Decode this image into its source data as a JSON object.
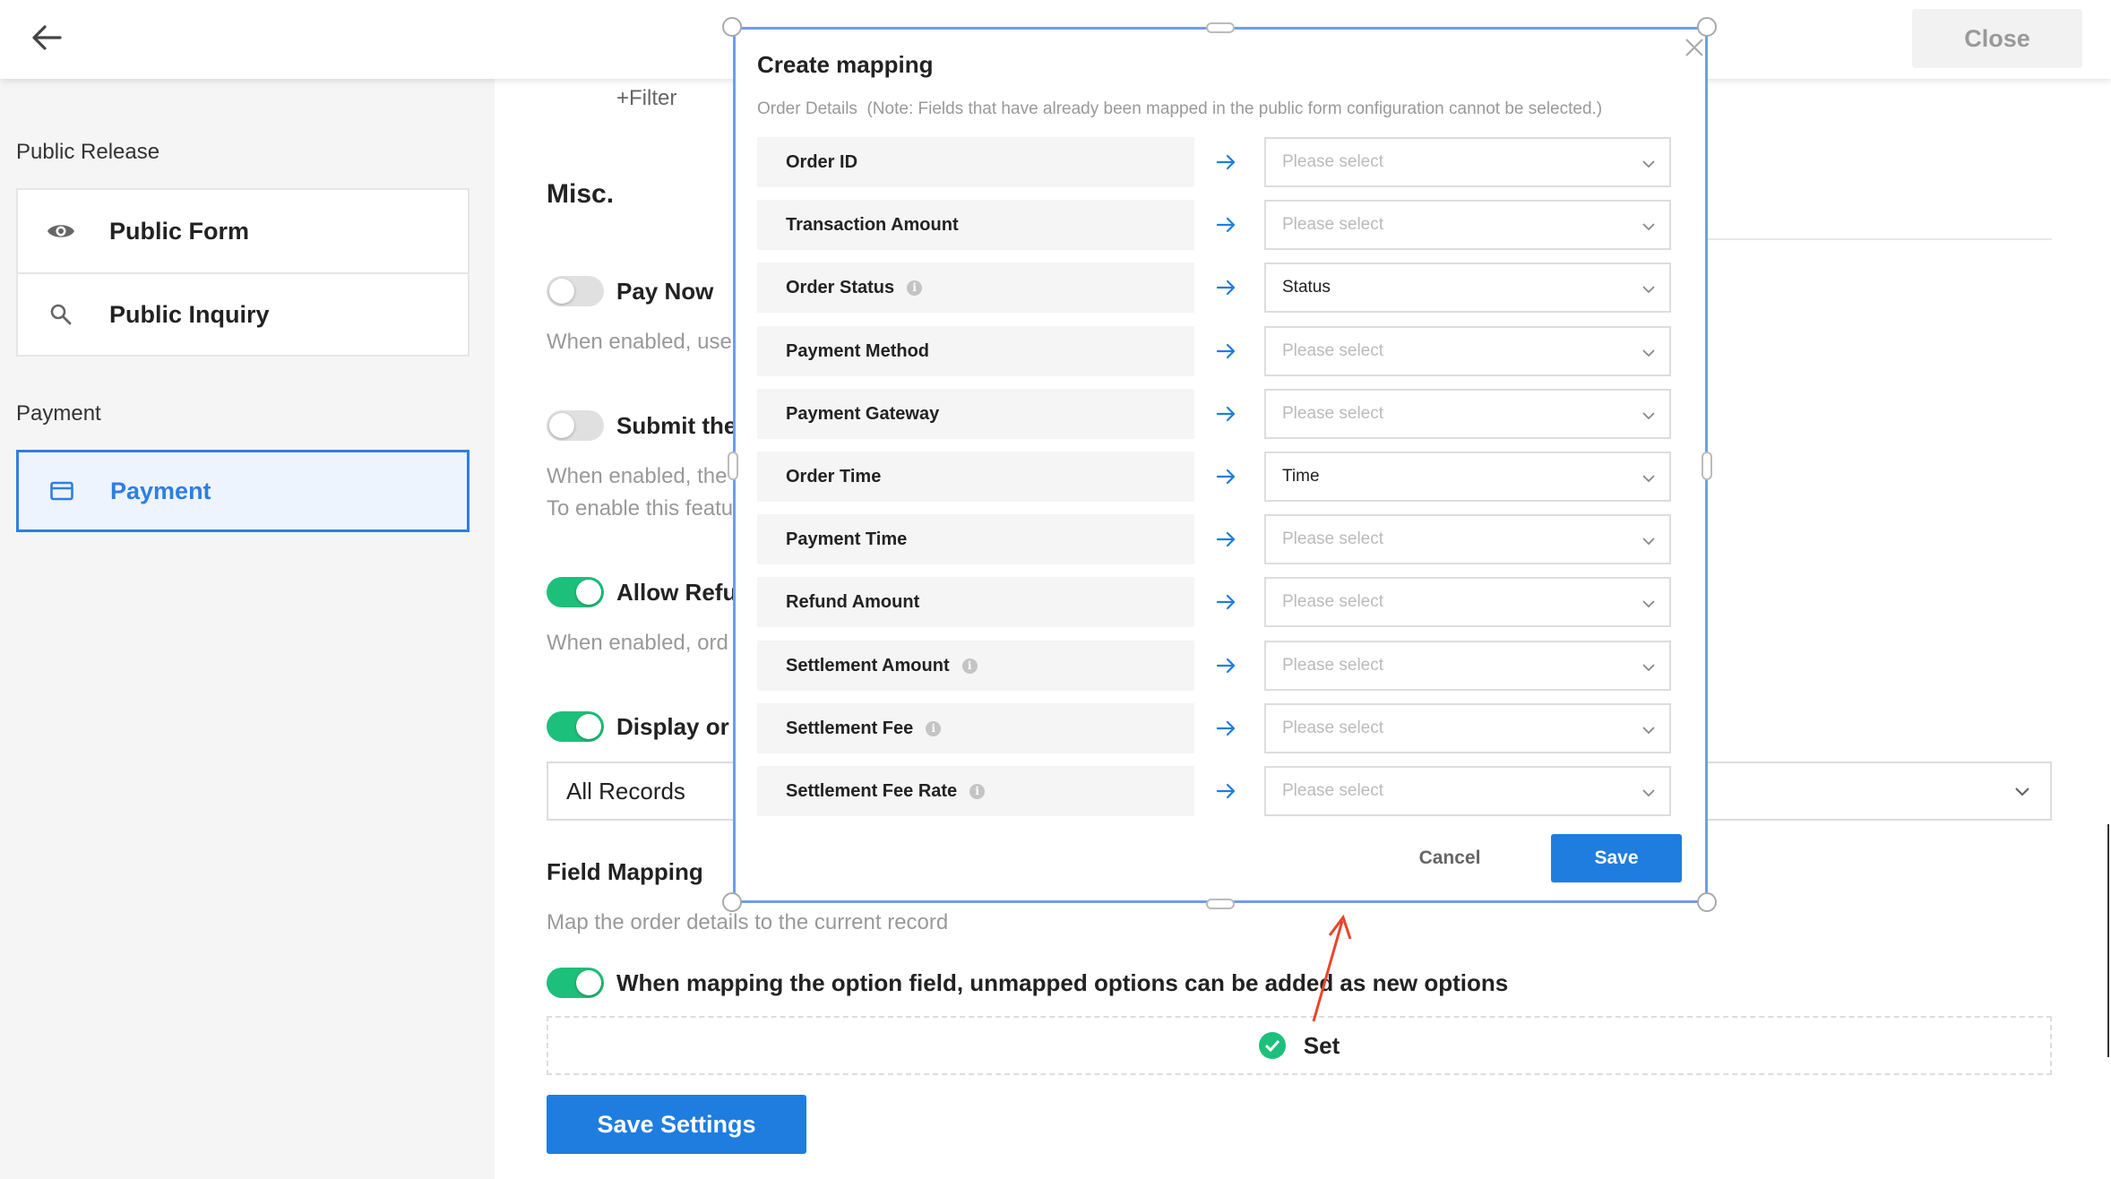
{
  "topbar": {
    "close_label": "Close"
  },
  "sidebar": {
    "section1_title": "Public Release",
    "items": [
      {
        "label": "Public Form",
        "icon": "eye-icon"
      },
      {
        "label": "Public Inquiry",
        "icon": "search-icon"
      }
    ],
    "section2_title": "Payment",
    "payment_item": {
      "label": "Payment",
      "icon": "card-icon"
    }
  },
  "main": {
    "filter_label": "+Filter",
    "misc_title": "Misc.",
    "options": [
      {
        "label": "Pay Now",
        "enabled": false,
        "desc": "When enabled, use"
      },
      {
        "label": "Submit the",
        "enabled": false,
        "desc": "When enabled, the",
        "desc2": "To enable this featu"
      },
      {
        "label": "Allow Refu",
        "enabled": true,
        "desc": "When enabled, ord"
      },
      {
        "label": "Display or",
        "enabled": true
      }
    ],
    "records_select": "All Records",
    "field_mapping_title": "Field Mapping",
    "field_mapping_desc": "Map the order details to the current record",
    "option_toggle_label": "When mapping the option field, unmapped options can be added as new options",
    "set_label": "Set",
    "save_settings_label": "Save Settings"
  },
  "modal": {
    "title": "Create mapping",
    "note": "Order Details  (Note: Fields that have already been mapped in the public form configuration cannot be selected.)",
    "rows": [
      {
        "field": "Order ID",
        "info": false,
        "value": "Please select",
        "filled": false
      },
      {
        "field": "Transaction Amount",
        "info": false,
        "value": "Please select",
        "filled": false
      },
      {
        "field": "Order Status",
        "info": true,
        "value": "Status",
        "filled": true
      },
      {
        "field": "Payment Method",
        "info": false,
        "value": "Please select",
        "filled": false
      },
      {
        "field": "Payment Gateway",
        "info": false,
        "value": "Please select",
        "filled": false
      },
      {
        "field": "Order Time",
        "info": false,
        "value": "Time",
        "filled": true
      },
      {
        "field": "Payment Time",
        "info": false,
        "value": "Please select",
        "filled": false
      },
      {
        "field": "Refund Amount",
        "info": false,
        "value": "Please select",
        "filled": false
      },
      {
        "field": "Settlement Amount",
        "info": true,
        "value": "Please select",
        "filled": false
      },
      {
        "field": "Settlement Fee",
        "info": true,
        "value": "Please select",
        "filled": false
      },
      {
        "field": "Settlement Fee Rate",
        "info": true,
        "value": "Please select",
        "filled": false
      }
    ],
    "cancel_label": "Cancel",
    "save_label": "Save"
  },
  "colors": {
    "accent": "#1f7de0",
    "toggle_on": "#1dc07a",
    "modal_border": "#6f9ee8",
    "annotation": "#e8452c"
  }
}
